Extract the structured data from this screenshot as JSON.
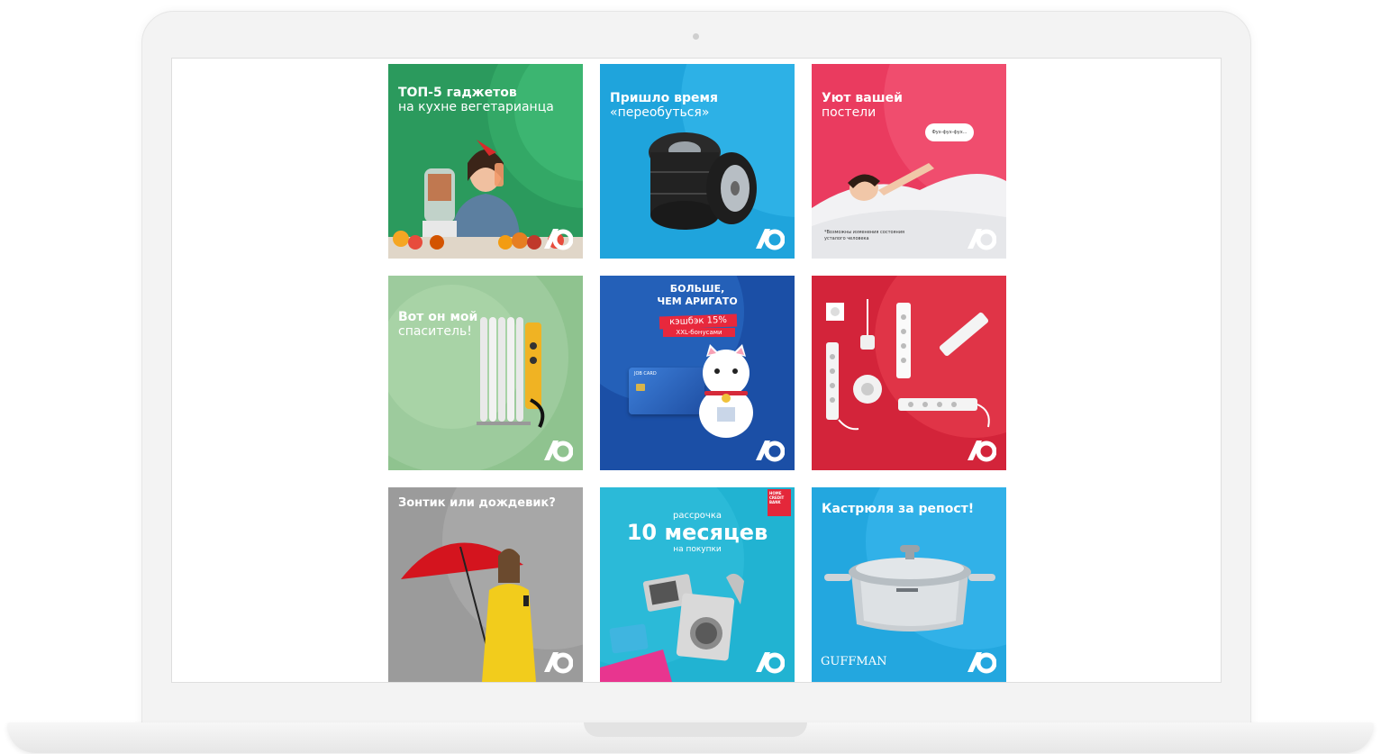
{
  "tiles": [
    {
      "title": "ТОП-5 гаджетов",
      "subtitle": "на кухне вегетарианца"
    },
    {
      "title": "Пришло время",
      "subtitle": "«переобуться»"
    },
    {
      "title": "Уют вашей",
      "subtitle": "постели",
      "bubble": "Фух-фух-фух...",
      "caption": "*Возможны изменения состояния усталого человека"
    },
    {
      "title": "Вот он мой",
      "subtitle": "спаситель!"
    },
    {
      "title": "БОЛЬШЕ,",
      "title2": "ЧЕМ АРИГАТО",
      "badge": "кэшбэк 15%",
      "badge_sub": "XXL-бонусами",
      "card_label": "JOB CARD"
    },
    {
      "title": ""
    },
    {
      "title": "Зонтик или дождевик?"
    },
    {
      "top": "рассрочка",
      "title": "10 месяцев",
      "subtitle": "на покупки",
      "bank": "HOME CREDIT BANK"
    },
    {
      "title": "Кастрюля за репост!",
      "brand": "GUFFMAN"
    }
  ]
}
